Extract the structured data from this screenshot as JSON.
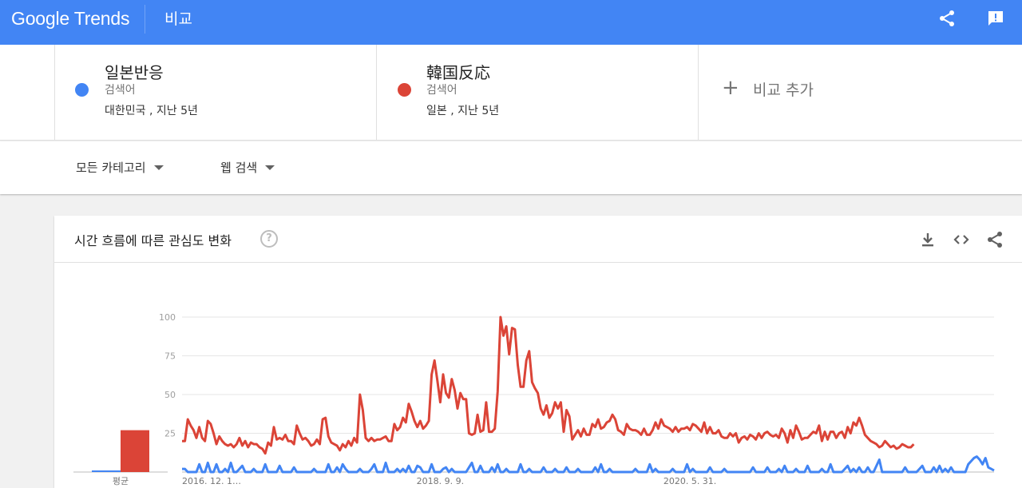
{
  "header": {
    "logo": "Google Trends",
    "page_title": "비교",
    "icons": [
      "share-icon",
      "feedback-icon"
    ]
  },
  "terms": [
    {
      "name": "일본반응",
      "type": "검색어",
      "location": "대한민국 , 지난 5년",
      "color": "#4285f4"
    },
    {
      "name": "韓国反応",
      "type": "검색어",
      "location": "일본 , 지난 5년",
      "color": "#db4437"
    }
  ],
  "add_compare": {
    "label": "비교 추가"
  },
  "filters": {
    "category": "모든 카테고리",
    "search_type": "웹 검색"
  },
  "interest_card": {
    "title": "시간 흐름에 따른 관심도 변화",
    "icons": [
      "help-icon",
      "download-icon",
      "embed-icon",
      "share-icon"
    ],
    "avg_label": "평균"
  },
  "chart_data": {
    "type": "line",
    "title": "",
    "xlabel": "",
    "ylabel": "",
    "ylim": [
      0,
      100
    ],
    "yticks": [
      25,
      50,
      75,
      100
    ],
    "grid": true,
    "legend": "none",
    "x_tick_labels": [
      "2016. 12. 1…",
      "2018. 9. 9.",
      "2020. 5. 31."
    ],
    "x_tick_index": [
      0,
      90,
      177
    ],
    "averages": [
      {
        "name": "일본반응",
        "value": 1,
        "color": "#4285f4"
      },
      {
        "name": "韓国反応",
        "value": 27,
        "color": "#db4437"
      }
    ],
    "series": [
      {
        "name": "일본반응",
        "color": "#4285f4",
        "values": [
          2,
          2,
          0,
          0,
          0,
          0,
          5,
          0,
          0,
          6,
          0,
          0,
          5,
          0,
          0,
          2,
          0,
          6,
          0,
          0,
          2,
          4,
          0,
          0,
          0,
          2,
          0,
          0,
          0,
          5,
          0,
          0,
          0,
          0,
          4,
          0,
          0,
          0,
          0,
          3,
          0,
          0,
          0,
          0,
          0,
          0,
          2,
          0,
          0,
          0,
          0,
          5,
          0,
          0,
          3,
          0,
          5,
          2,
          0,
          0,
          0,
          0,
          2,
          0,
          0,
          0,
          2,
          5,
          0,
          0,
          0,
          6,
          0,
          0,
          0,
          2,
          0,
          2,
          0,
          4,
          0,
          0,
          4,
          3,
          0,
          0,
          0,
          5,
          0,
          0,
          0,
          2,
          3,
          0,
          2,
          0,
          0,
          0,
          0,
          0,
          3,
          6,
          0,
          0,
          4,
          0,
          0,
          0,
          3,
          0,
          5,
          0,
          0,
          2,
          0,
          0,
          0,
          0,
          5,
          0,
          0,
          2,
          0,
          0,
          0,
          0,
          3,
          0,
          0,
          0,
          2,
          0,
          0,
          0,
          3,
          0,
          0,
          0,
          2,
          0,
          0,
          0,
          0,
          0,
          3,
          0,
          5,
          0,
          0,
          2,
          0,
          0,
          0,
          0,
          0,
          0,
          0,
          0,
          2,
          0,
          0,
          0,
          0,
          5,
          0,
          2,
          0,
          0,
          0,
          0,
          0,
          2,
          0,
          0,
          0,
          0,
          5,
          0,
          2,
          0,
          0,
          0,
          0,
          0,
          3,
          0,
          0,
          0,
          0,
          2,
          0,
          0,
          0,
          0,
          0,
          0,
          0,
          0,
          0,
          3,
          0,
          0,
          0,
          0,
          3,
          0,
          0,
          0,
          2,
          0,
          4,
          0,
          0,
          0,
          2,
          0,
          0,
          0,
          4,
          0,
          0,
          0,
          0,
          2,
          0,
          0,
          5,
          0,
          0,
          0,
          0,
          2,
          4,
          0,
          2,
          0,
          3,
          0,
          0,
          3,
          0,
          0,
          4,
          8,
          0,
          0,
          0,
          0,
          0,
          0,
          0,
          0,
          3,
          0,
          0,
          0,
          0,
          2,
          4,
          0,
          0,
          0,
          3,
          0,
          4,
          0,
          2,
          0,
          3,
          0,
          0,
          0,
          0,
          0,
          5,
          7,
          9,
          10,
          8,
          5,
          9,
          3,
          2,
          1
        ]
      },
      {
        "name": "韓国反応",
        "color": "#db4437",
        "values": [
          20,
          20,
          34,
          30,
          27,
          22,
          29,
          22,
          20,
          33,
          31,
          25,
          18,
          23,
          20,
          18,
          17,
          18,
          16,
          18,
          22,
          17,
          20,
          16,
          19,
          18,
          18,
          16,
          15,
          12,
          19,
          17,
          29,
          21,
          22,
          21,
          24,
          20,
          20,
          18,
          30,
          25,
          21,
          22,
          20,
          17,
          18,
          21,
          18,
          34,
          35,
          23,
          19,
          18,
          17,
          14,
          18,
          16,
          20,
          17,
          22,
          19,
          50,
          40,
          22,
          20,
          22,
          20,
          21,
          21,
          22,
          23,
          20,
          20,
          31,
          27,
          29,
          35,
          32,
          44,
          39,
          33,
          29,
          33,
          28,
          30,
          33,
          63,
          72,
          59,
          45,
          63,
          51,
          48,
          60,
          53,
          41,
          51,
          47,
          47,
          25,
          24,
          25,
          37,
          26,
          27,
          45,
          26,
          26,
          28,
          52,
          100,
          88,
          94,
          76,
          93,
          92,
          69,
          55,
          55,
          72,
          78,
          58,
          54,
          51,
          41,
          37,
          43,
          35,
          38,
          45,
          41,
          45,
          26,
          40,
          36,
          21,
          24,
          27,
          23,
          28,
          24,
          24,
          31,
          29,
          34,
          28,
          29,
          32,
          33,
          37,
          34,
          27,
          26,
          24,
          31,
          28,
          27,
          27,
          26,
          24,
          28,
          24,
          24,
          27,
          32,
          28,
          34,
          30,
          29,
          28,
          26,
          29,
          26,
          28,
          28,
          29,
          27,
          31,
          30,
          28,
          26,
          32,
          25,
          29,
          25,
          25,
          27,
          23,
          22,
          22,
          25,
          23,
          25,
          19,
          22,
          23,
          21,
          24,
          23,
          21,
          25,
          22,
          25,
          26,
          24,
          23,
          24,
          22,
          28,
          25,
          19,
          27,
          22,
          30,
          26,
          21,
          22,
          22,
          24,
          26,
          25,
          30,
          20,
          26,
          21,
          26,
          26,
          22,
          25,
          26,
          22,
          29,
          25,
          32,
          30,
          35,
          30,
          24,
          22,
          20,
          19,
          18,
          16,
          17,
          20,
          18,
          16,
          17,
          15,
          16,
          18,
          17,
          16,
          16,
          18
        ]
      }
    ]
  }
}
